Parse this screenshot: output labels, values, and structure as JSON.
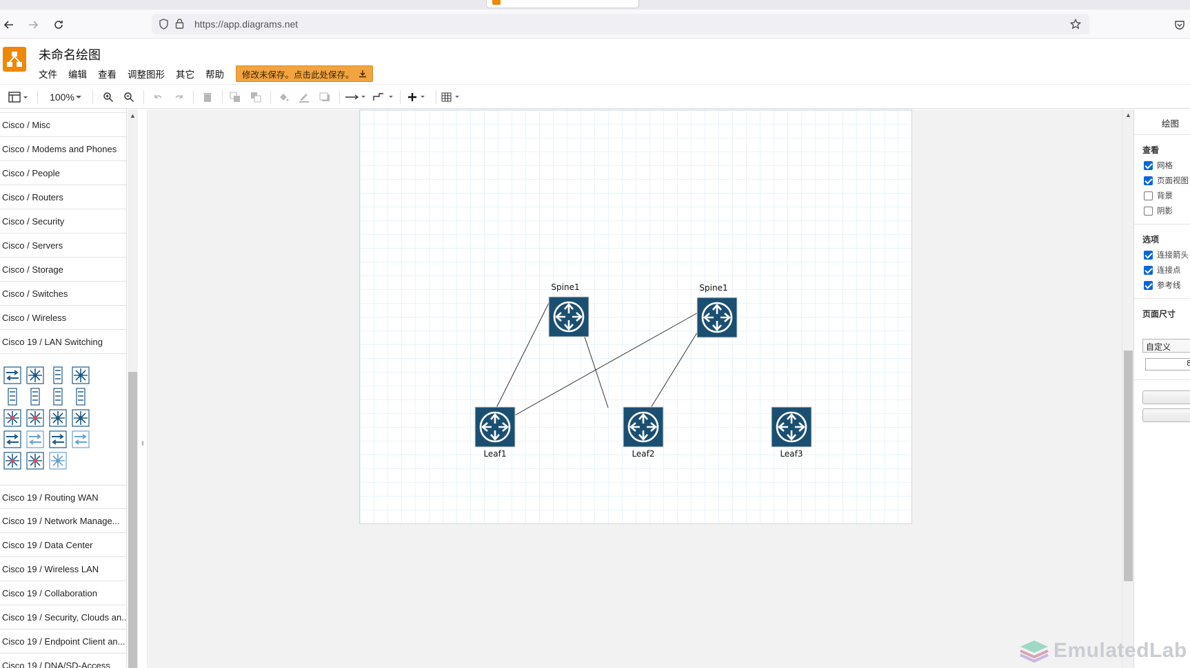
{
  "browser": {
    "url": "https://app.diagrams.net"
  },
  "app": {
    "title": "未命名绘图",
    "menu": [
      "文件",
      "编辑",
      "查看",
      "调整图形",
      "其它",
      "帮助"
    ],
    "unsaved_notice": "修改未保存。点击此处保存。"
  },
  "toolbar": {
    "zoom": "100%"
  },
  "sidebar": {
    "items": [
      "Cisco / Misc",
      "Cisco / Modems and Phones",
      "Cisco / People",
      "Cisco / Routers",
      "Cisco / Security",
      "Cisco / Servers",
      "Cisco / Storage",
      "Cisco / Switches",
      "Cisco / Wireless",
      "Cisco 19 / LAN Switching"
    ],
    "items_after": [
      "Cisco 19 / Routing WAN",
      "Cisco 19 / Network Manage...",
      "Cisco 19 / Data Center",
      "Cisco 19 / Wireless LAN",
      "Cisco 19 / Collaboration",
      "Cisco 19 / Security, Clouds an...",
      "Cisco 19 / Endpoint Client an...",
      "Cisco 19 / DNA/SD-Access"
    ]
  },
  "diagram": {
    "nodes": [
      {
        "id": "spine1a",
        "label": "Spine1",
        "icon": "router-icon"
      },
      {
        "id": "spine1b",
        "label": "Spine1",
        "icon": "router-icon"
      },
      {
        "id": "leaf1",
        "label": "Leaf1",
        "icon": "router-icon"
      },
      {
        "id": "leaf2",
        "label": "Leaf2",
        "icon": "router-icon"
      },
      {
        "id": "leaf3",
        "label": "Leaf3",
        "icon": "router-icon"
      }
    ],
    "edges": [
      [
        "spine1a",
        "leaf1"
      ],
      [
        "spine1a",
        "leaf2"
      ],
      [
        "spine1b",
        "leaf1"
      ],
      [
        "spine1b",
        "leaf2"
      ]
    ],
    "node_color": "#1b4f72"
  },
  "format_panel": {
    "tab": "绘图",
    "view_heading": "查看",
    "view_options": [
      {
        "label": "网格",
        "checked": true
      },
      {
        "label": "页面视图",
        "checked": true
      },
      {
        "label": "背景",
        "checked": false
      },
      {
        "label": "阴影",
        "checked": false
      }
    ],
    "options_heading": "选项",
    "options": [
      {
        "label": "连接箭头",
        "checked": true
      },
      {
        "label": "连接点",
        "checked": true
      },
      {
        "label": "参考线",
        "checked": true
      }
    ],
    "page_size_heading": "页面尺寸",
    "page_size_value": "自定义",
    "page_width_value": "8"
  },
  "watermark": "EmulatedLab"
}
